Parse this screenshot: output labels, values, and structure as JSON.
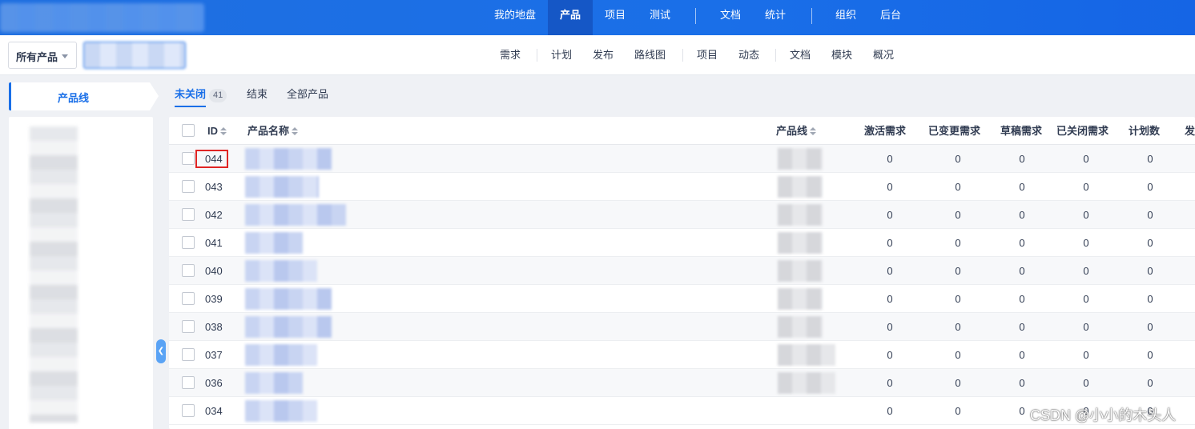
{
  "top_nav": {
    "items": [
      {
        "label": "我的地盘",
        "active": false
      },
      {
        "label": "产品",
        "active": true
      },
      {
        "label": "项目",
        "active": false
      },
      {
        "label": "测试",
        "active": false
      },
      {
        "label": "文档",
        "active": false
      },
      {
        "label": "统计",
        "active": false
      },
      {
        "label": "组织",
        "active": false
      },
      {
        "label": "后台",
        "active": false
      }
    ]
  },
  "sub_nav": {
    "product_select": "所有产品",
    "items": [
      "需求",
      "计划",
      "发布",
      "路线图",
      "项目",
      "动态",
      "文档",
      "模块",
      "概况"
    ]
  },
  "sidebar": {
    "tab_label": "产品线"
  },
  "status_tabs": {
    "open": "未关闭",
    "open_count": "41",
    "closed": "结束",
    "all": "全部产品"
  },
  "table": {
    "headers": {
      "id": "ID",
      "name": "产品名称",
      "line": "产品线",
      "active_stories": "激活需求",
      "changed_stories": "已变更需求",
      "draft_stories": "草稿需求",
      "closed_stories": "已关闭需求",
      "plans": "计划数",
      "releases": "发"
    },
    "rows": [
      {
        "id": "044",
        "active": "0",
        "changed": "0",
        "draft": "0",
        "closed": "0",
        "plans": "0"
      },
      {
        "id": "043",
        "active": "0",
        "changed": "0",
        "draft": "0",
        "closed": "0",
        "plans": "0"
      },
      {
        "id": "042",
        "active": "0",
        "changed": "0",
        "draft": "0",
        "closed": "0",
        "plans": "0"
      },
      {
        "id": "041",
        "active": "0",
        "changed": "0",
        "draft": "0",
        "closed": "0",
        "plans": "0"
      },
      {
        "id": "040",
        "active": "0",
        "changed": "0",
        "draft": "0",
        "closed": "0",
        "plans": "0"
      },
      {
        "id": "039",
        "active": "0",
        "changed": "0",
        "draft": "0",
        "closed": "0",
        "plans": "0"
      },
      {
        "id": "038",
        "active": "0",
        "changed": "0",
        "draft": "0",
        "closed": "0",
        "plans": "0"
      },
      {
        "id": "037",
        "active": "0",
        "changed": "0",
        "draft": "0",
        "closed": "0",
        "plans": "0"
      },
      {
        "id": "036",
        "active": "0",
        "changed": "0",
        "draft": "0",
        "closed": "0",
        "plans": "0"
      },
      {
        "id": "034",
        "active": "0",
        "changed": "0",
        "draft": "0",
        "closed": "0",
        "plans": "0"
      }
    ]
  },
  "watermark": "CSDN @小小的木头人",
  "colors": {
    "primary": "#1a6fe8",
    "highlight": "#e02424"
  }
}
